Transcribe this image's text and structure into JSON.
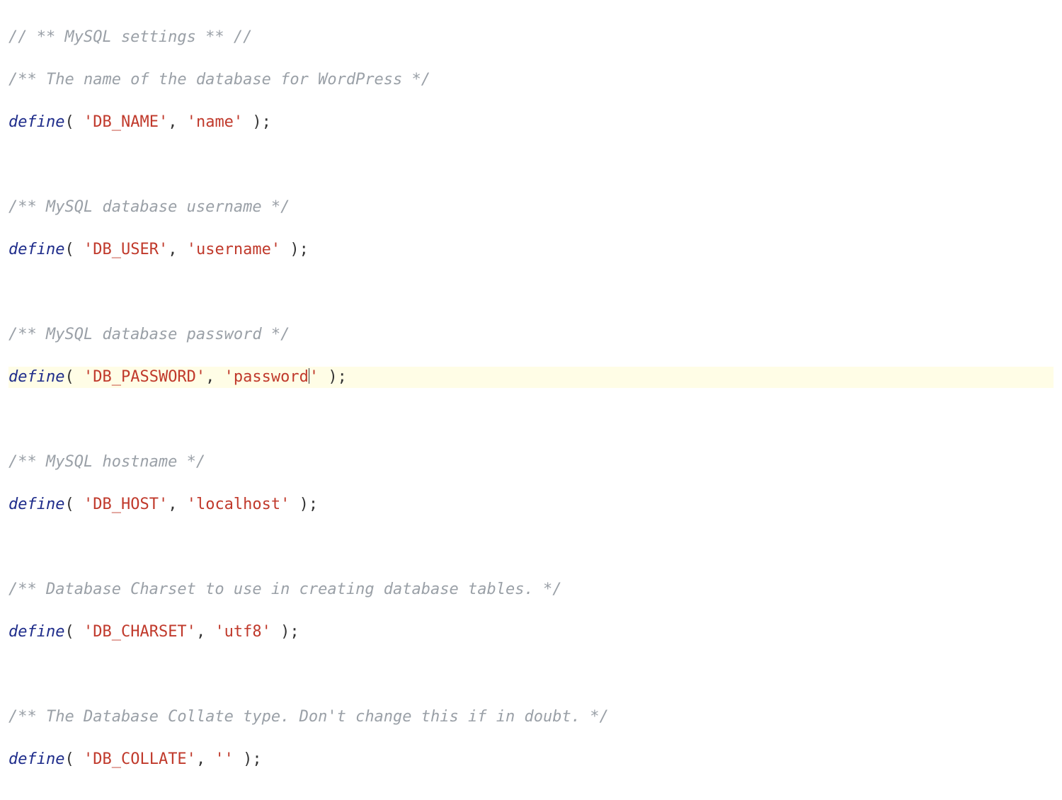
{
  "code": {
    "c0": "// ** MySQL settings ** //",
    "c1": "/** The name of the database for WordPress */",
    "c2": "/** MySQL database username */",
    "c3": "/** MySQL database password */",
    "c4": "/** MySQL hostname */",
    "c5": "/** Database Charset to use in creating database tables. */",
    "c6": "/** The Database Collate type. Don't change this if in doubt. */",
    "fn": "define",
    "op": "( ",
    "sep": ", ",
    "cl": " );",
    "s_db_name_k": "'DB_NAME'",
    "s_db_name_v": "'name'",
    "s_db_user_k": "'DB_USER'",
    "s_db_user_v": "'username'",
    "s_db_pass_k": "'DB_PASSWORD'",
    "s_db_pass_v1": "'password",
    "s_db_pass_v2": "'",
    "s_db_host_k": "'DB_HOST'",
    "s_db_host_v": "'localhost'",
    "s_db_charset_k": "'DB_CHARSET'",
    "s_db_charset_v": "'utf8'",
    "s_db_collate_k": "'DB_COLLATE'",
    "s_db_collate_v": "''"
  }
}
